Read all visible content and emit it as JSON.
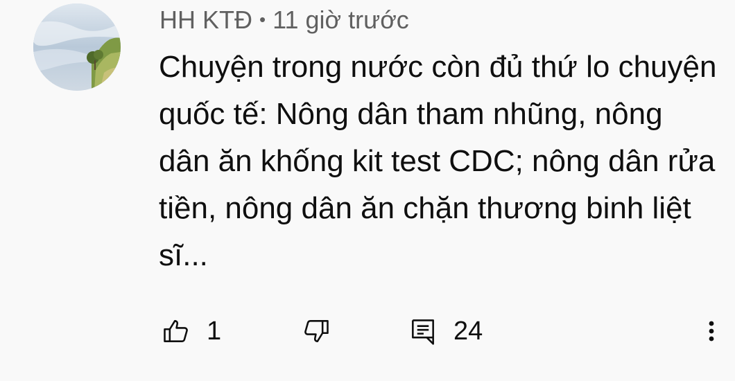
{
  "comment": {
    "author": "HH KTĐ",
    "separator": "•",
    "timestamp": "11 giờ trước",
    "text": "Chuyện trong nước còn đủ thứ lo chuyện quốc tế: Nông dân tham nhũng, nông dân ăn khống kit test CDC; nông dân rửa tiền, nông dân ăn chặn thương binh liệt sĩ...",
    "like_count": "1",
    "reply_count": "24"
  },
  "icons": {
    "like": "thumbs-up-icon",
    "dislike": "thumbs-down-icon",
    "reply": "comment-icon",
    "more": "more-vertical-icon"
  }
}
